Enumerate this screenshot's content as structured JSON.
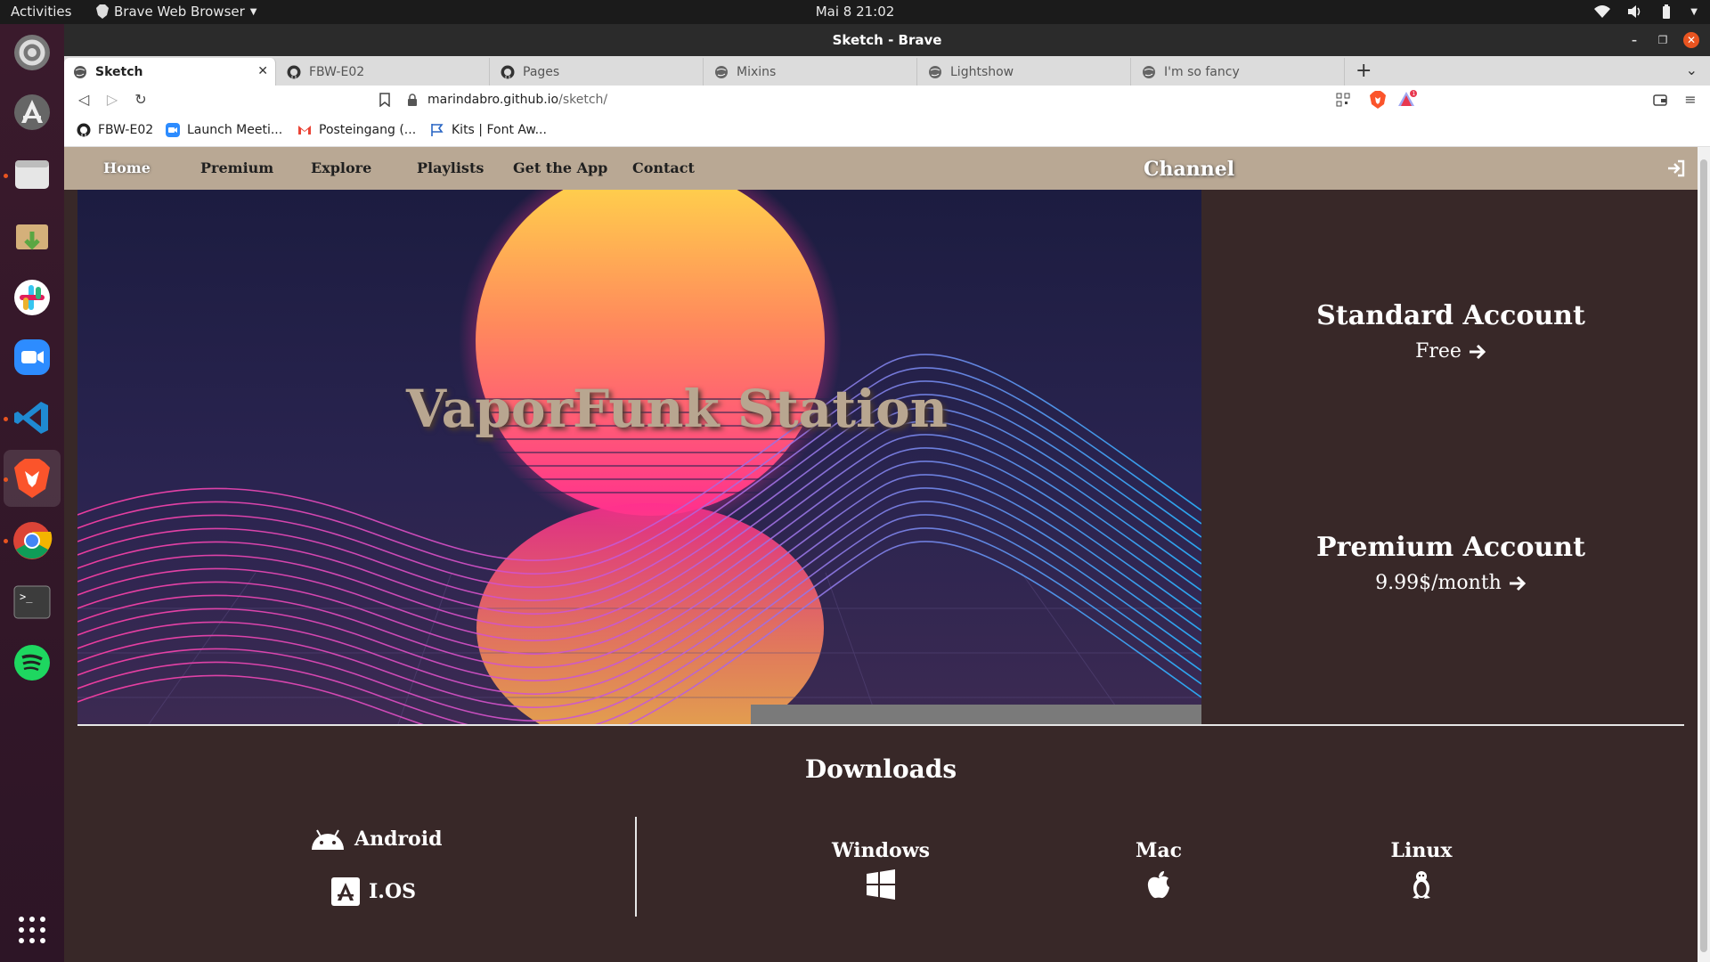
{
  "system": {
    "activities": "Activities",
    "app_name": "Brave Web Browser",
    "clock": "Mai 8  21:02"
  },
  "window": {
    "title": "Sketch - Brave"
  },
  "tabs": [
    {
      "label": "Sketch",
      "icon": "globe-icon",
      "active": true
    },
    {
      "label": "FBW-E02",
      "icon": "github-icon"
    },
    {
      "label": "Pages",
      "icon": "github-icon"
    },
    {
      "label": "Mixins",
      "icon": "globe-icon"
    },
    {
      "label": "Lightshow",
      "icon": "globe-icon"
    },
    {
      "label": "I'm so fancy",
      "icon": "globe-icon"
    }
  ],
  "address": {
    "host": "marindabro.github.io",
    "path": "/sketch/"
  },
  "bookmarks": [
    {
      "label": "FBW-E02",
      "icon": "github-icon"
    },
    {
      "label": "Launch Meeti...",
      "icon": "zoom-icon"
    },
    {
      "label": "Posteingang (...",
      "icon": "gmail-icon"
    },
    {
      "label": "Kits | Font Aw...",
      "icon": "flag-icon"
    }
  ],
  "site": {
    "nav": [
      "Home",
      "Premium",
      "Explore",
      "Playlists",
      "Get the App",
      "Contact"
    ],
    "channel": "Channel",
    "hero_title": "VaporFunk Station",
    "standard": {
      "title": "Standard Account",
      "price": "Free"
    },
    "premium": {
      "title": "Premium Account",
      "price": "9.99$/month"
    },
    "downloads": {
      "title": "Downloads",
      "mobile": [
        "Android",
        "I.OS"
      ],
      "desktop": [
        "Windows",
        "Mac",
        "Linux"
      ]
    }
  },
  "colors": {
    "nav_bg": "#b9a894",
    "page_bg": "#382828",
    "dock_bg": "#3a1a2c",
    "accent": "#e95420"
  }
}
